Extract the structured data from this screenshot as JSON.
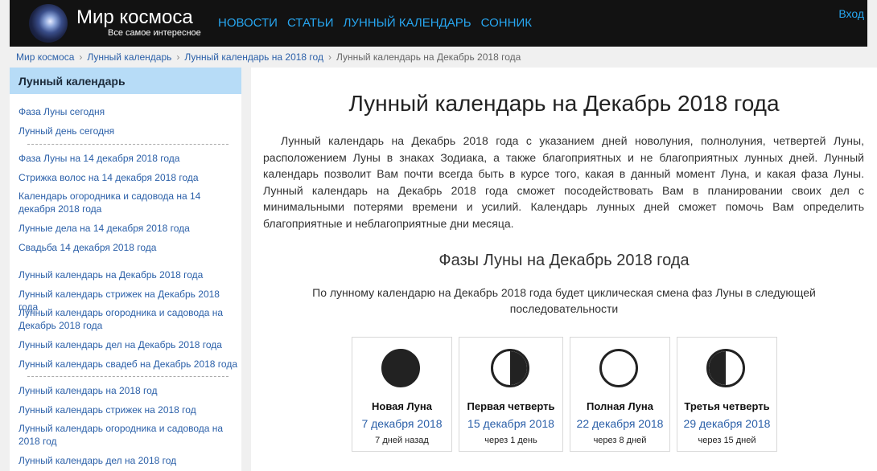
{
  "header": {
    "site_title": "Мир космоса",
    "site_subtitle": "Все самое интересное",
    "nav": [
      "НОВОСТИ",
      "СТАТЬИ",
      "ЛУННЫЙ КАЛЕНДАРЬ",
      "СОННИК"
    ],
    "login": "Вход"
  },
  "breadcrumbs": {
    "items": [
      "Мир космоса",
      "Лунный календарь",
      "Лунный календарь на 2018 год"
    ],
    "current": "Лунный календарь на Декабрь 2018 года",
    "separator": "›"
  },
  "sidebar": {
    "title": "Лунный календарь",
    "links": [
      "Фаза Луны сегодня",
      "Лунный день сегодня",
      "Фаза Луны на 14 декабря 2018 года",
      "Стрижка волос на 14 декабря 2018 года",
      "Календарь огородника и садовода на 14 декабря 2018 года",
      "Лунные дела на 14 декабря 2018 года",
      "Свадьба 14 декабря 2018 года",
      "Лунный календарь на Декабрь 2018 года",
      "Лунный календарь стрижек на Декабрь 2018 года",
      "Лунный календарь огородника и садовода на Декабрь 2018 года",
      "Лунный календарь дел на Декабрь 2018 года",
      "Лунный календарь свадеб на Декабрь 2018 года",
      "Лунный календарь на 2018 год",
      "Лунный календарь стрижек на 2018 год",
      "Лунный календарь огородника и садовода на 2018 год",
      "Лунный календарь дел на 2018 год"
    ]
  },
  "main": {
    "title": "Лунный календарь на Декабрь 2018 года",
    "intro": "Лунный календарь на Декабрь 2018 года с указанием дней новолуния, полнолуния, четвертей Луны, расположением Луны в знаках Зодиака, а также благоприятных и не благоприятных лунных дней. Лунный календарь позволит Вам почти всегда быть в курсе того, какая в данный момент Луна, и какая фаза Луны. Лунный календарь на Декабрь 2018 года сможет посодействовать Вам в планировании своих дел с минимальными потерями времени и усилий. Календарь лунных дней сможет помочь Вам определить благоприятные и неблагоприятные дни месяца.",
    "phases_title": "Фазы Луны на Декабрь 2018 года",
    "phases_desc": "По лунному календарю на Декабрь 2018 года будет циклическая смена фаз Луны в следующей последовательности",
    "phases": [
      {
        "name": "Новая Луна",
        "date": "7 декабря 2018",
        "note": "7 дней назад",
        "icon": "new-moon-icon"
      },
      {
        "name": "Первая четверть",
        "date": "15 декабря 2018",
        "note": "через 1 день",
        "icon": "first-quarter-moon-icon"
      },
      {
        "name": "Полная Луна",
        "date": "22 декабря 2018",
        "note": "через 8 дней",
        "icon": "full-moon-icon"
      },
      {
        "name": "Третья четверть",
        "date": "29 декабря 2018",
        "note": "через 15 дней",
        "icon": "last-quarter-moon-icon"
      }
    ]
  },
  "colors": {
    "header_bg": "#121212",
    "nav_link": "#27a6f0",
    "link": "#2a5fa8",
    "sidebar_header_bg": "#b7dcf7"
  }
}
